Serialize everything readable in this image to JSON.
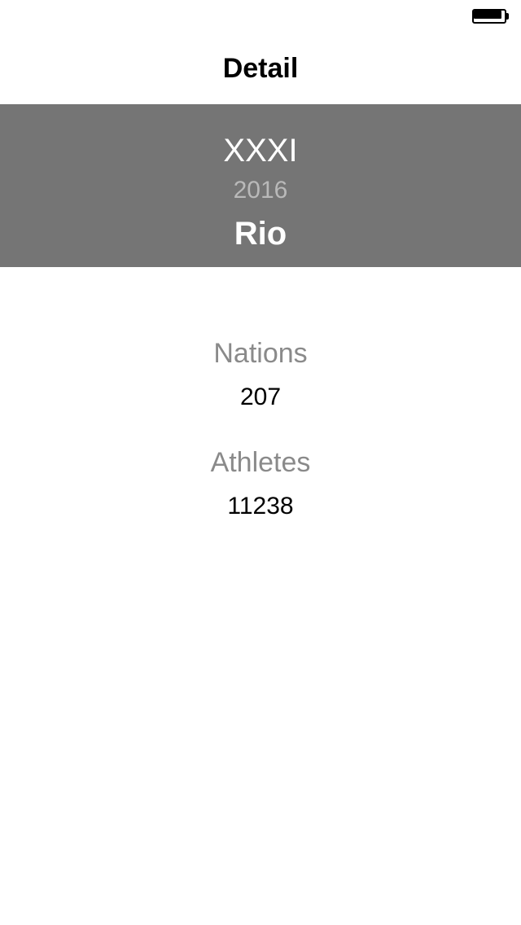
{
  "nav": {
    "title": "Detail"
  },
  "status_bar": {
    "battery_icon": "battery-full-icon"
  },
  "games": {
    "numeral": "XXXI",
    "year": "2016",
    "city": "Rio"
  },
  "stats": {
    "nations_label": "Nations",
    "nations_value": "207",
    "athletes_label": "Athletes",
    "athletes_value": "11238"
  },
  "colors": {
    "banner_background": "#757575",
    "label_gray": "#8a8a8a",
    "year_gray": "#b9b9b9"
  }
}
